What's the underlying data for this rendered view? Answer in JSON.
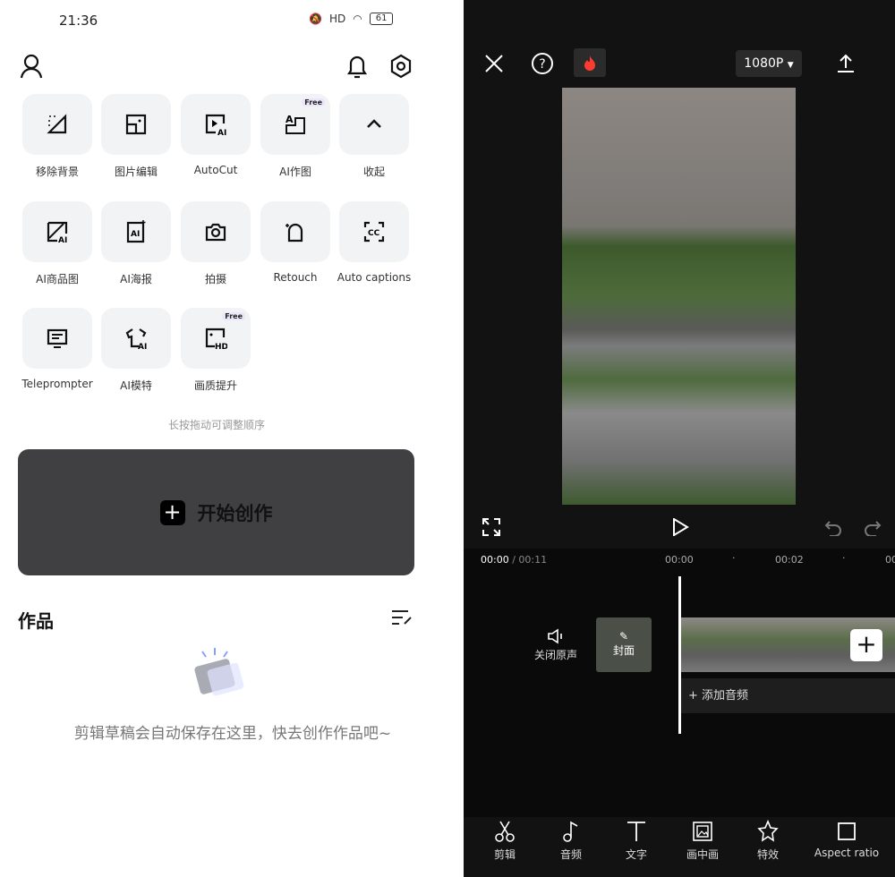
{
  "status": {
    "time": "21:36",
    "battery": "61",
    "network": "HD"
  },
  "tools": [
    {
      "label": "移除背景",
      "icon": "remove-background-icon"
    },
    {
      "label": "图片编辑",
      "icon": "image-edit-icon"
    },
    {
      "label": "AutoCut",
      "icon": "autocut-icon"
    },
    {
      "label": "AI作图",
      "icon": "ai-image-icon",
      "badge": "Free"
    },
    {
      "label": "收起",
      "icon": "chevron-up-icon"
    },
    {
      "label": "AI商品图",
      "icon": "ai-product-icon"
    },
    {
      "label": "AI海报",
      "icon": "ai-poster-icon"
    },
    {
      "label": "拍摄",
      "icon": "camera-icon"
    },
    {
      "label": "Retouch",
      "icon": "retouch-icon"
    },
    {
      "label": "Auto captions",
      "icon": "captions-icon"
    },
    {
      "label": "Teleprompter",
      "icon": "teleprompter-icon"
    },
    {
      "label": "AI模特",
      "icon": "ai-model-icon"
    },
    {
      "label": "画质提升",
      "icon": "hd-enhance-icon",
      "badge": "Free"
    }
  ],
  "hint": "长按拖动可调整顺序",
  "create_label": "开始创作",
  "works_title": "作品",
  "empty_text": "剪辑草稿会自动保存在这里，快去创作作品吧~",
  "editor": {
    "resolution": "1080P",
    "current_time": "00:00",
    "total_time": "/ 00:11",
    "ticks": [
      "00:00",
      "00:02",
      "00"
    ],
    "mute_label": "关闭原声",
    "cover_label": "封面",
    "add_audio": "添加音频",
    "toolbar": [
      {
        "label": "剪辑",
        "icon": "scissors-icon"
      },
      {
        "label": "音频",
        "icon": "music-note-icon"
      },
      {
        "label": "文字",
        "icon": "text-icon"
      },
      {
        "label": "画中画",
        "icon": "picture-in-picture-icon"
      },
      {
        "label": "特效",
        "icon": "effects-star-icon"
      },
      {
        "label": "Aspect ratio",
        "icon": "aspect-ratio-icon"
      }
    ]
  },
  "colors": {
    "accent_red": "#ff3b30",
    "dark_bg": "#121212",
    "tile_bg": "#f2f3f5"
  }
}
